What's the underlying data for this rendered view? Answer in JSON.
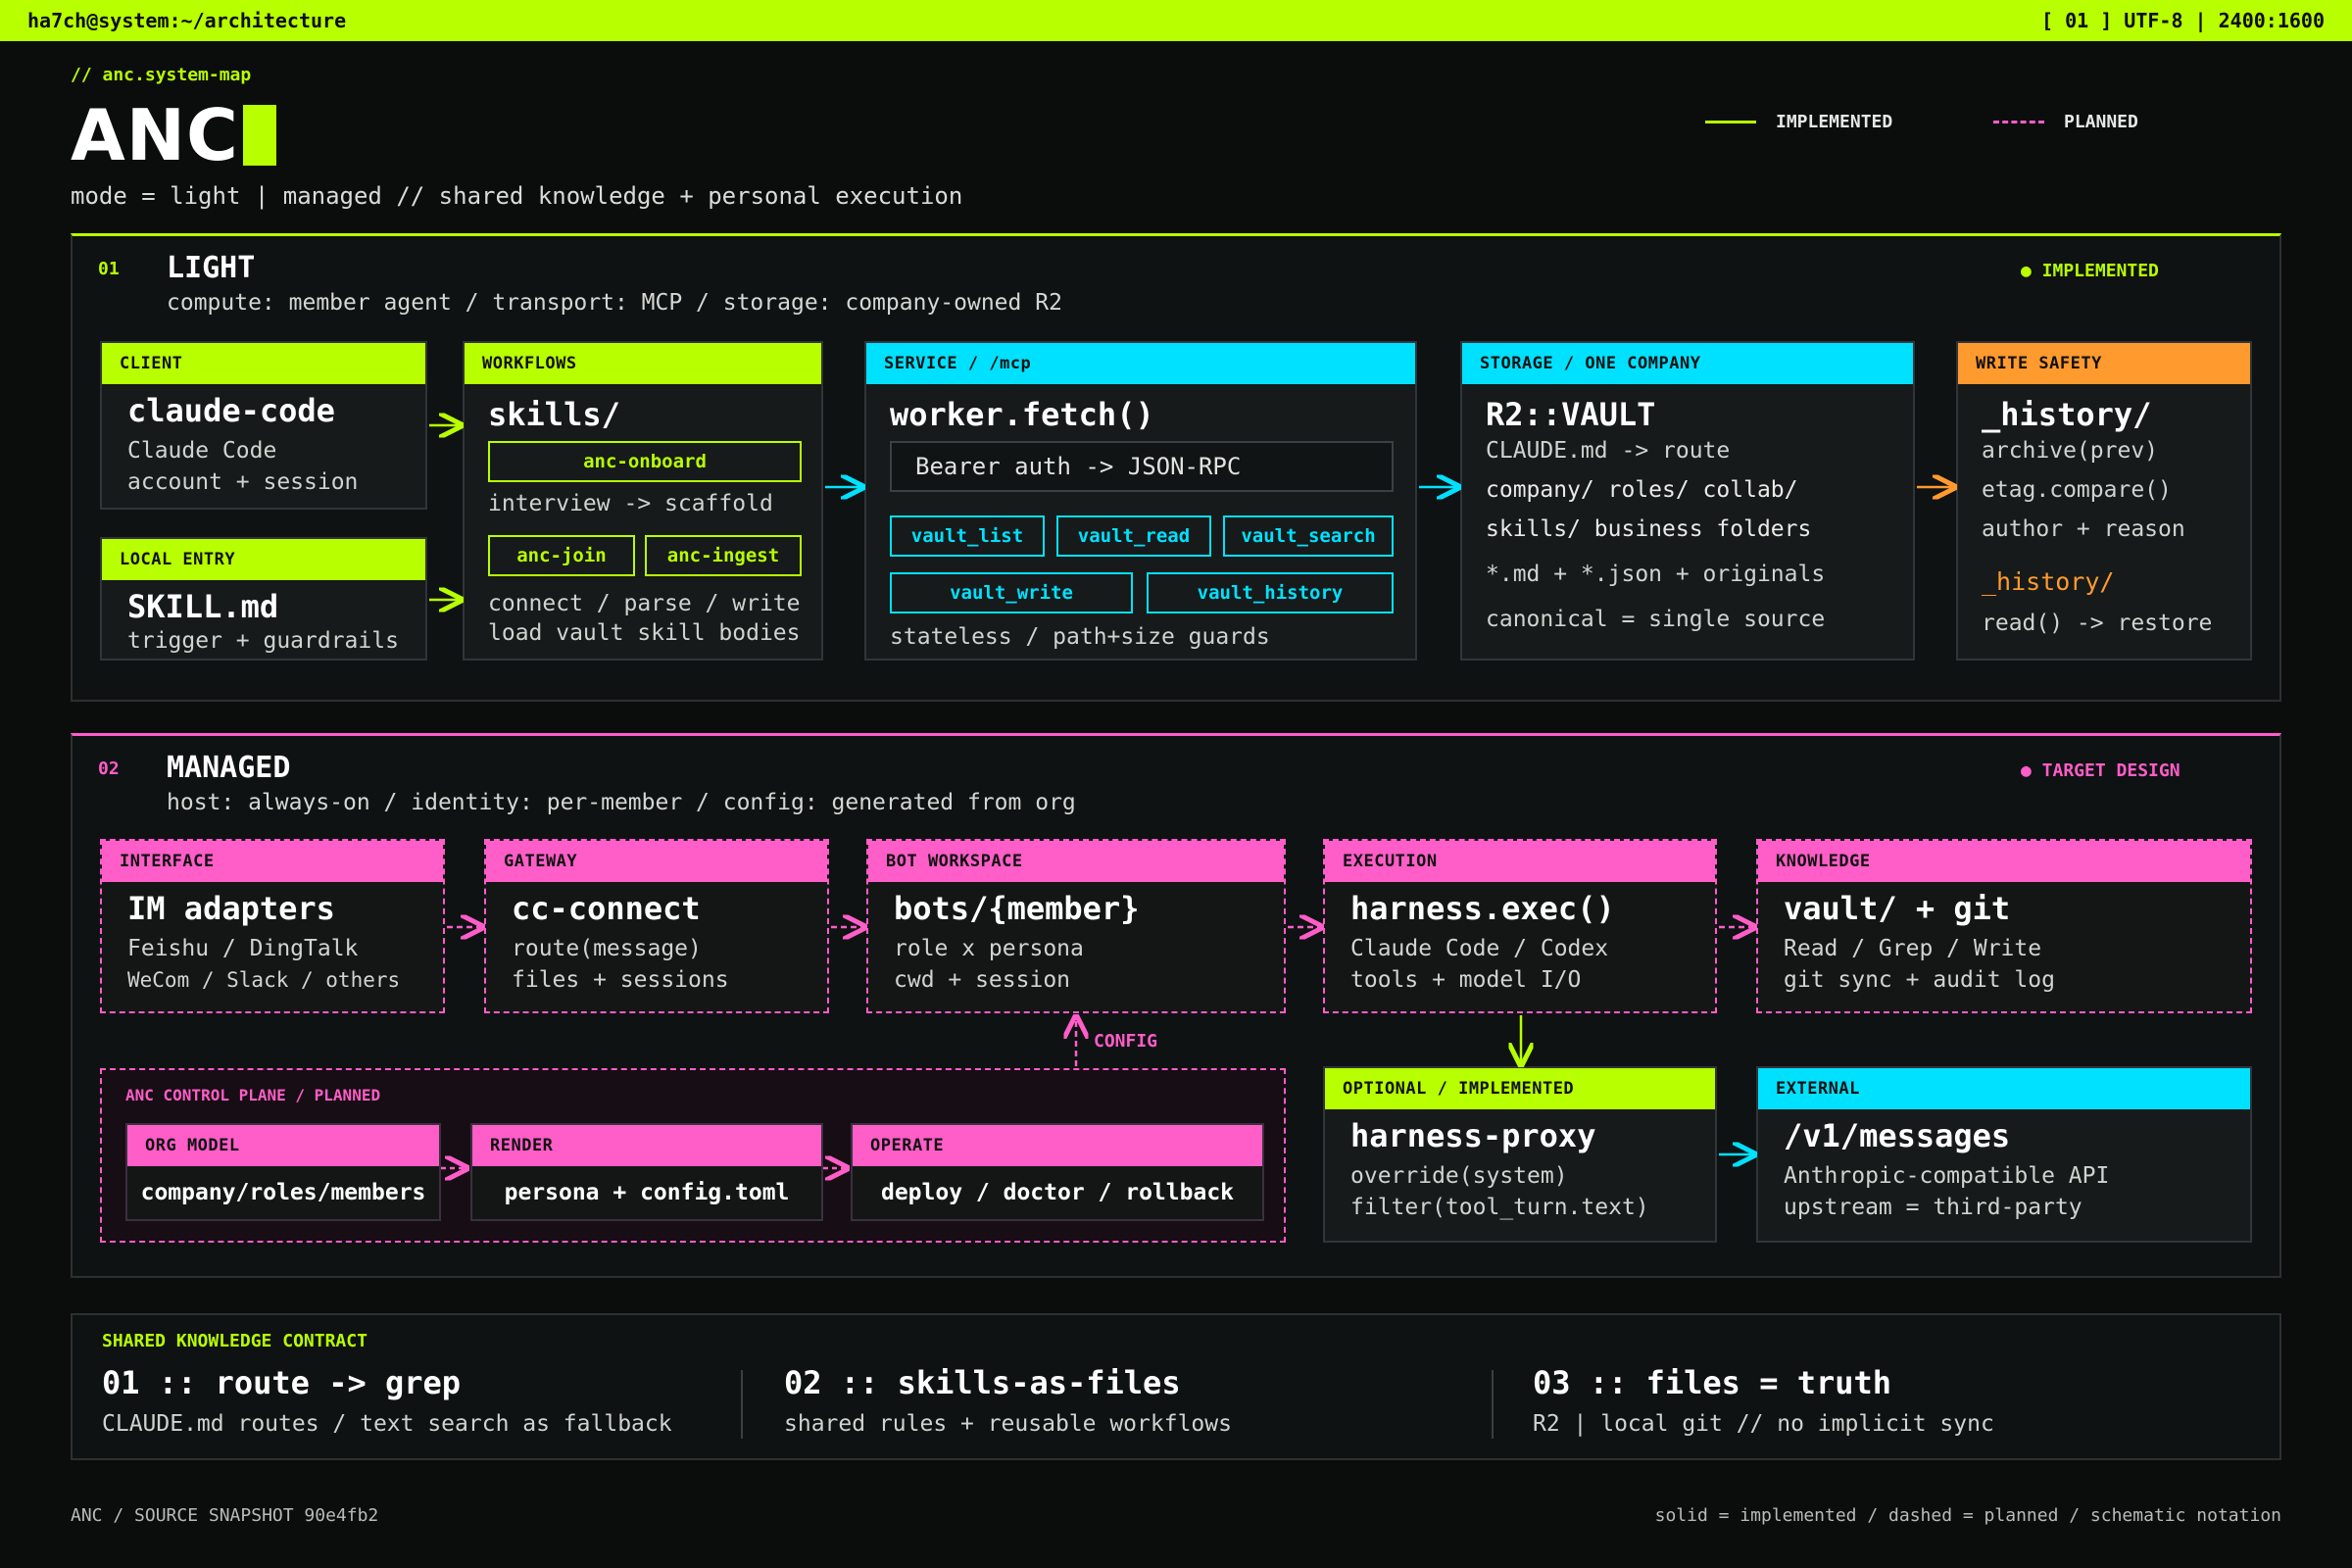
{
  "topbar": {
    "path": "ha7ch@system:~/architecture",
    "status": "[ 01 ] UTF-8 | 2400:1600"
  },
  "header": {
    "kicker": "// anc.system-map",
    "title": "ANC",
    "mode": "mode = light | managed // shared knowledge + personal execution",
    "legend": {
      "implemented": "IMPLEMENTED",
      "planned": "PLANNED"
    }
  },
  "colors": {
    "lime": "#b8ff00",
    "cyan": "#00e1ff",
    "pink": "#ff5dc8",
    "orange": "#ff9a2e",
    "bg": "#0b0d0d"
  },
  "light": {
    "num": "01",
    "title": "LIGHT",
    "subtitle": "compute: member agent / transport: MCP / storage: company-owned R2",
    "badge": "● IMPLEMENTED",
    "client": {
      "header": "CLIENT",
      "title": "claude-code",
      "lines": [
        "Claude Code",
        "account + session"
      ]
    },
    "local": {
      "header": "LOCAL ENTRY",
      "title": "SKILL.md",
      "lines": [
        "trigger + guardrails"
      ]
    },
    "workflows": {
      "header": "WORKFLOWS",
      "title": "skills/",
      "chip_onboard": "anc-onboard",
      "line1": "interview -> scaffold",
      "chip_join": "anc-join",
      "chip_ingest": "anc-ingest",
      "line2": "connect / parse / write",
      "line3": "load vault skill bodies"
    },
    "service": {
      "header": "SERVICE / /mcp",
      "title": "worker.fetch()",
      "bearer": "Bearer auth -> JSON-RPC",
      "tools": [
        "vault_list",
        "vault_read",
        "vault_search",
        "vault_write",
        "vault_history"
      ],
      "footer": "stateless / path+size guards"
    },
    "storage": {
      "header": "STORAGE / ONE COMPANY",
      "title": "R2::VAULT",
      "lines": [
        "CLAUDE.md -> route",
        "company/ roles/ collab/",
        "skills/ business folders",
        "*.md + *.json + originals",
        "canonical = single source"
      ]
    },
    "safety": {
      "header": "WRITE SAFETY",
      "title": "_history/",
      "lines": [
        "archive(prev)",
        "etag.compare()",
        "author + reason"
      ],
      "sub_title": "_history/",
      "sub_line": "read() -> restore"
    }
  },
  "managed": {
    "num": "02",
    "title": "MANAGED",
    "subtitle": "host: always-on / identity: per-member / config: generated from org",
    "badge": "● TARGET DESIGN",
    "interface": {
      "header": "INTERFACE",
      "title": "IM adapters",
      "lines": [
        "Feishu / DingTalk",
        "WeCom / Slack / others"
      ]
    },
    "gateway": {
      "header": "GATEWAY",
      "title": "cc-connect",
      "lines": [
        "route(message)",
        "files + sessions"
      ]
    },
    "workspace": {
      "header": "BOT WORKSPACE",
      "title": "bots/{member}",
      "lines": [
        "role x persona",
        "cwd + session"
      ]
    },
    "execution": {
      "header": "EXECUTION",
      "title": "harness.exec()",
      "lines": [
        "Claude Code / Codex",
        "tools + model I/O"
      ]
    },
    "knowledge": {
      "header": "KNOWLEDGE",
      "title": "vault/ + git",
      "lines": [
        "Read / Grep / Write",
        "git sync + audit log"
      ]
    },
    "config_label": "CONFIG",
    "plane": {
      "title": "ANC CONTROL PLANE / PLANNED",
      "org": {
        "header": "ORG MODEL",
        "body": "company/roles/members"
      },
      "render": {
        "header": "RENDER",
        "body": "persona + config.toml"
      },
      "operate": {
        "header": "OPERATE",
        "body": "deploy / doctor / rollback"
      }
    },
    "proxy": {
      "header": "OPTIONAL / IMPLEMENTED",
      "title": "harness-proxy",
      "lines": [
        "override(system)",
        "filter(tool_turn.text)"
      ]
    },
    "external": {
      "header": "EXTERNAL",
      "title": "/v1/messages",
      "lines": [
        "Anthropic-compatible API",
        "upstream = third-party"
      ]
    }
  },
  "contract": {
    "header": "SHARED KNOWLEDGE CONTRACT",
    "items": [
      {
        "title": "01 :: route -> grep",
        "text": "CLAUDE.md routes / text search as fallback"
      },
      {
        "title": "02 :: skills-as-files",
        "text": "shared rules + reusable workflows"
      },
      {
        "title": "03 :: files = truth",
        "text": "R2 | local git // no implicit sync"
      }
    ]
  },
  "footer": {
    "left": "ANC / SOURCE SNAPSHOT 90e4fb2",
    "right": "solid = implemented / dashed = planned / schematic notation"
  }
}
